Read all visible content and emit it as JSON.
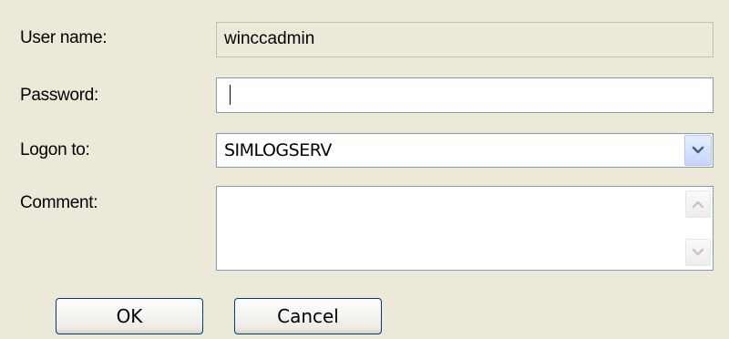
{
  "form": {
    "username_label": "User name:",
    "username_value": "winccadmin",
    "password_label": "Password:",
    "password_value": "",
    "logon_label": "Logon to:",
    "logon_value": "SIMLOGSERV",
    "comment_label": "Comment:",
    "comment_value": ""
  },
  "buttons": {
    "ok_label": "OK",
    "cancel_label": "Cancel"
  },
  "icons": {
    "dropdown": "chevron-down-icon",
    "scroll_up": "scroll-up-icon",
    "scroll_down": "scroll-down-icon"
  },
  "colors": {
    "background": "#ece9d8",
    "field_border": "#7f9db9",
    "button_border": "#003c74"
  }
}
